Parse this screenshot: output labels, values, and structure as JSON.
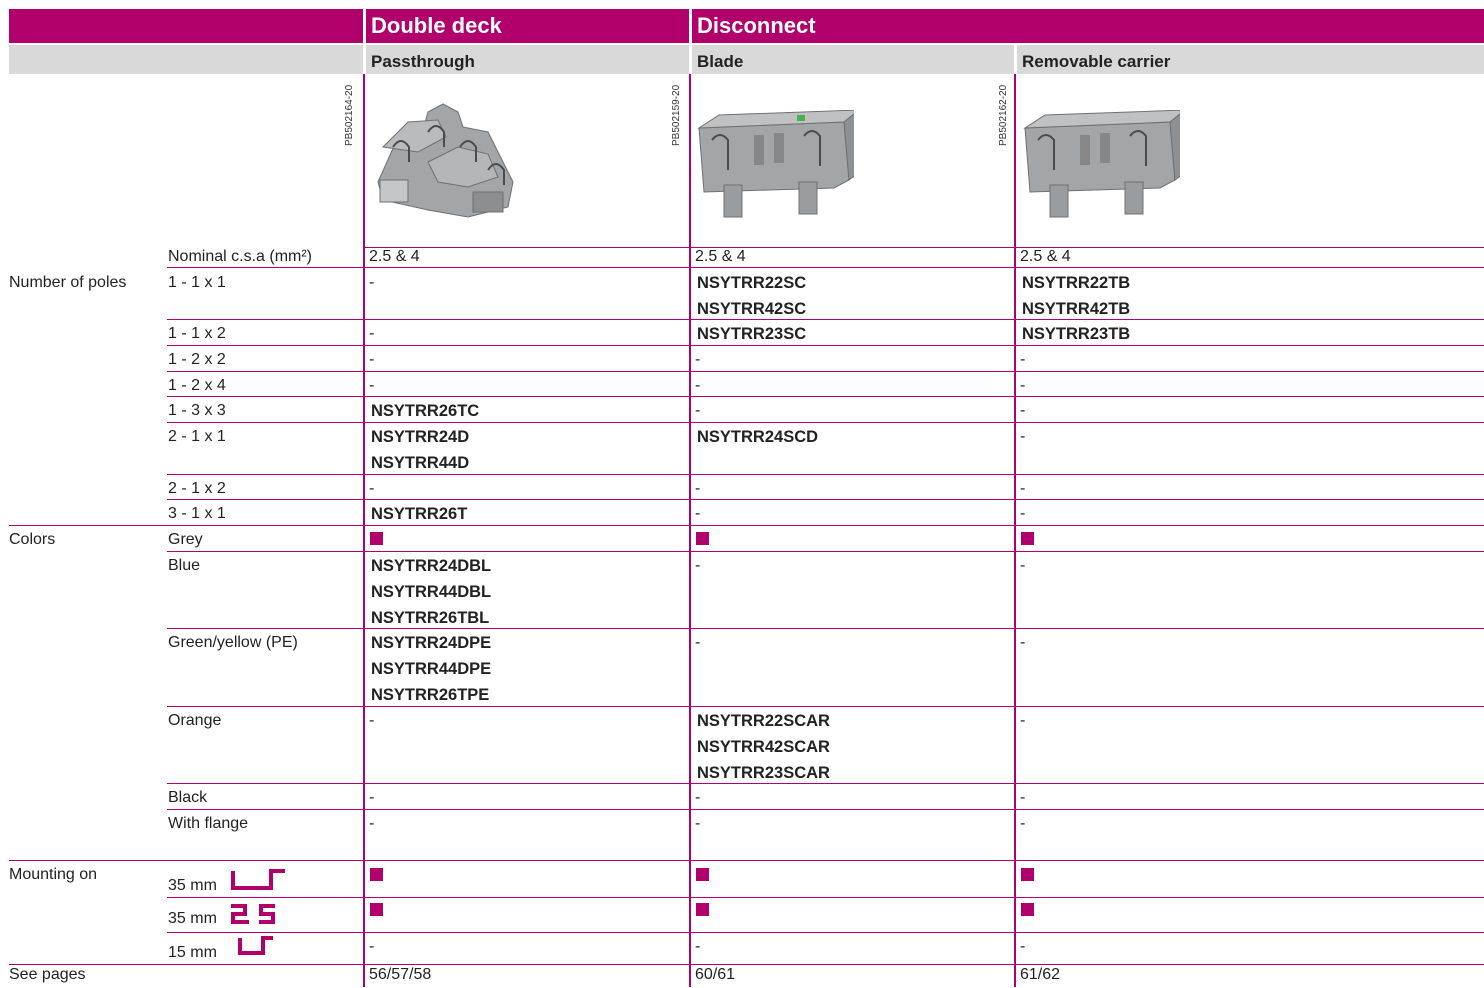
{
  "header": {
    "groups": [
      "Double deck",
      "Disconnect"
    ],
    "subtypes": [
      "Passthrough",
      "Blade",
      "Removable carrier"
    ],
    "refs": [
      "PB502164-20",
      "PB502159-20",
      "PB502162-20"
    ]
  },
  "rows": {
    "csa": {
      "label": "Nominal c.s.a (mm²)",
      "values": [
        "2.5 & 4",
        "2.5 & 4",
        "2.5 & 4"
      ]
    },
    "poles_group": "Number of poles",
    "poles": [
      {
        "label": "1 - 1 x 1",
        "c1": "-",
        "c2": [
          "NSYTRR22SC",
          "NSYTRR42SC"
        ],
        "c3": [
          "NSYTRR22TB",
          "NSYTRR42TB"
        ]
      },
      {
        "label": "1 - 1 x 2",
        "c1": "-",
        "c2": [
          "NSYTRR23SC"
        ],
        "c3": [
          "NSYTRR23TB"
        ]
      },
      {
        "label": "1 - 2 x 2",
        "c1": "-",
        "c2": "-",
        "c3": "-"
      },
      {
        "label": "1 - 2 x 4",
        "c1": "-",
        "c2": "-",
        "c3": "-"
      },
      {
        "label": "1 - 3 x 3",
        "c1": [
          "NSYTRR26TC"
        ],
        "c2": "-",
        "c3": "-"
      },
      {
        "label": "2 - 1 x 1",
        "c1": [
          "NSYTRR24D",
          "NSYTRR44D"
        ],
        "c2": [
          "NSYTRR24SCD"
        ],
        "c3": "-"
      },
      {
        "label": "2 - 1 x 2",
        "c1": "-",
        "c2": "-",
        "c3": "-"
      },
      {
        "label": "3 - 1 x 1",
        "c1": [
          "NSYTRR26T"
        ],
        "c2": "-",
        "c3": "-"
      }
    ],
    "colors_group": "Colors",
    "colors": [
      {
        "label": "Grey"
      },
      {
        "label": "Blue",
        "c1": [
          "NSYTRR24DBL",
          "NSYTRR44DBL",
          "NSYTRR26TBL"
        ],
        "c2": "-",
        "c3": "-"
      },
      {
        "label": "Green/yellow (PE)",
        "c1": [
          "NSYTRR24DPE",
          "NSYTRR44DPE",
          "NSYTRR26TPE"
        ],
        "c2": "-",
        "c3": "-"
      },
      {
        "label": "Orange",
        "c1": "-",
        "c2": [
          "NSYTRR22SCAR",
          "NSYTRR42SCAR",
          "NSYTRR23SCAR"
        ],
        "c3": "-"
      },
      {
        "label": "Black",
        "c1": "-",
        "c2": "-",
        "c3": "-"
      },
      {
        "label": "With flange",
        "c1": "-",
        "c2": "-",
        "c3": "-"
      }
    ],
    "mounting_group": "Mounting on",
    "mounting": [
      {
        "label": "35 mm",
        "rail": "top-hat-rail-icon"
      },
      {
        "label": "35 mm",
        "rail": "g-profile-rail-icon"
      },
      {
        "label": "15 mm",
        "c1": "-",
        "c2": "-",
        "c3": "-",
        "rail": "mini-rail-icon"
      }
    ],
    "pages": {
      "label": "See pages",
      "values": [
        "56/57/58",
        "60/61",
        "61/62"
      ]
    }
  },
  "colors": {
    "accent": "#b1006b",
    "subheader": "#d9d9d9"
  }
}
